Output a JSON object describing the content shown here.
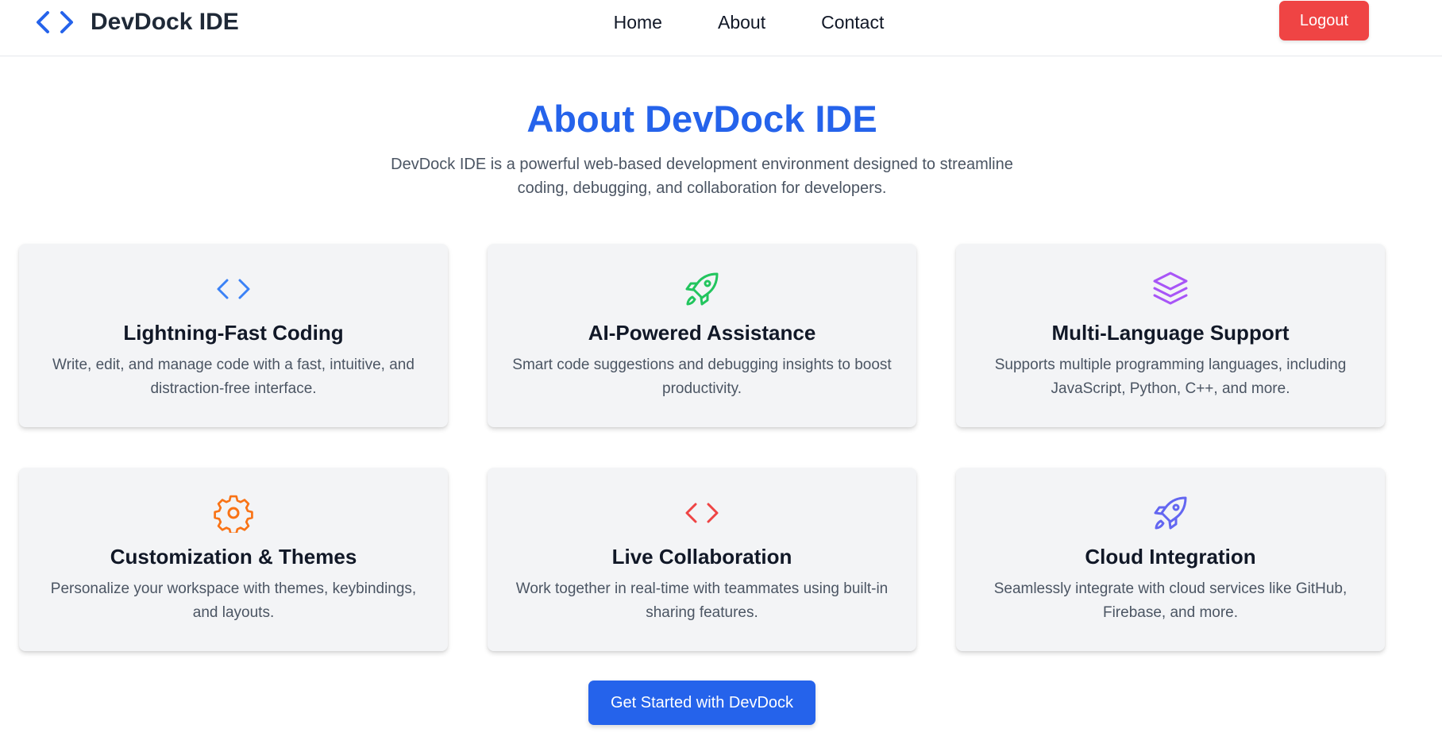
{
  "header": {
    "logo_icon": "code-brackets-icon",
    "brand_name": "DevDock IDE",
    "nav": [
      {
        "label": "Home"
      },
      {
        "label": "About"
      },
      {
        "label": "Contact"
      }
    ],
    "logout_label": "Logout"
  },
  "hero": {
    "title": "About DevDock IDE",
    "description": "DevDock IDE is a powerful web-based development environment designed to streamline coding, debugging, and collaboration for developers."
  },
  "features": [
    {
      "icon": "code-icon",
      "color": "#3b82f6",
      "title": "Lightning-Fast Coding",
      "description": "Write, edit, and manage code with a fast, intuitive, and distraction-free interface."
    },
    {
      "icon": "rocket-icon",
      "color": "#22c55e",
      "title": "AI-Powered Assistance",
      "description": "Smart code suggestions and debugging insights to boost productivity."
    },
    {
      "icon": "layers-icon",
      "color": "#a855f7",
      "title": "Multi-Language Support",
      "description": "Supports multiple programming languages, including JavaScript, Python, C++, and more."
    },
    {
      "icon": "gear-icon",
      "color": "#f97316",
      "title": "Customization & Themes",
      "description": "Personalize your workspace with themes, keybindings, and layouts."
    },
    {
      "icon": "code-icon",
      "color": "#ef4444",
      "title": "Live Collaboration",
      "description": "Work together in real-time with teammates using built-in sharing features."
    },
    {
      "icon": "rocket-icon",
      "color": "#6366f1",
      "title": "Cloud Integration",
      "description": "Seamlessly integrate with cloud services like GitHub, Firebase, and more."
    }
  ],
  "cta_label": "Get Started with DevDock",
  "colors": {
    "primary": "#2563eb",
    "danger": "#ef4444",
    "card_bg": "#f3f4f6"
  }
}
